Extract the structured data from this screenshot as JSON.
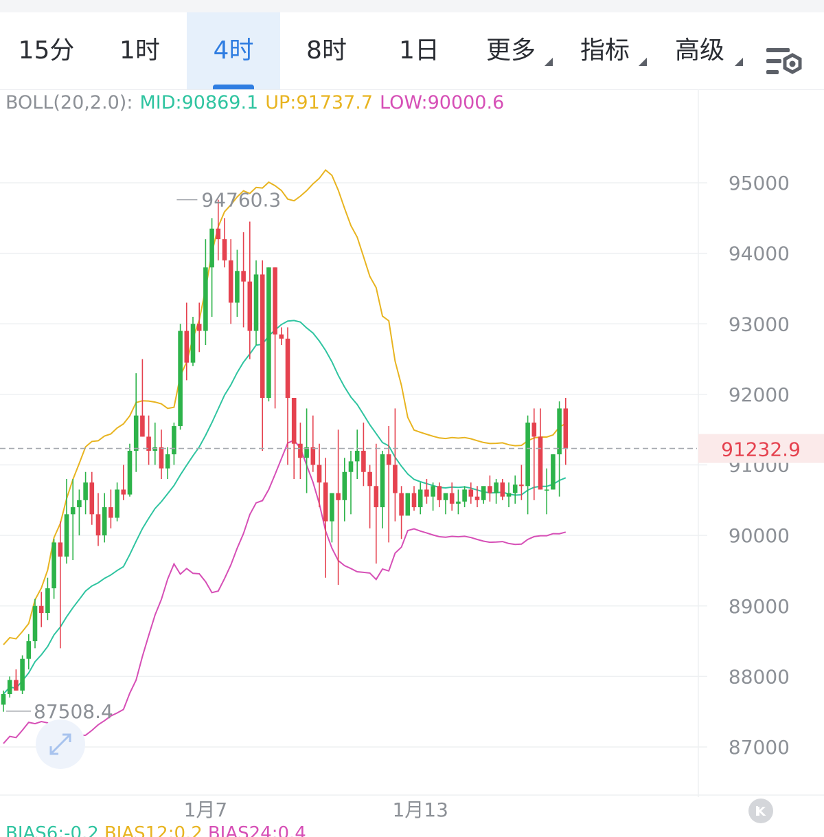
{
  "tabs": [
    {
      "label": "15分",
      "active": false,
      "dropdown": false
    },
    {
      "label": "1时",
      "active": false,
      "dropdown": false
    },
    {
      "label": "4时",
      "active": true,
      "dropdown": false
    },
    {
      "label": "8时",
      "active": false,
      "dropdown": false
    },
    {
      "label": "1日",
      "active": false,
      "dropdown": false
    },
    {
      "label": "更多",
      "active": false,
      "dropdown": true
    },
    {
      "label": "指标",
      "active": false,
      "dropdown": true
    },
    {
      "label": "高级",
      "active": false,
      "dropdown": true
    }
  ],
  "icons": {
    "settings": "chart-settings-icon",
    "collapse": "collapse-k-icon",
    "expand": "expand-arrows-icon"
  },
  "colors": {
    "up": "#2db34a",
    "down": "#e5424f",
    "mid": "#2fc4a0",
    "upper": "#e8b420",
    "lower": "#d64fb6",
    "active_tab": "#2f7de1",
    "price_line": "#e5424f"
  },
  "boll": {
    "name": "BOLL(20,2.0):",
    "mid": "MID:90869.1",
    "up": "UP:91737.7",
    "low": "LOW:90000.6"
  },
  "bias": {
    "b6": "BIAS6:-0.2",
    "b12": "BIAS12:0.2",
    "b24": "BIAS24:0.4"
  },
  "chart_data": {
    "type": "candlestick",
    "y_ticks": [
      95000,
      94000,
      93000,
      92000,
      91000,
      90000,
      89000,
      88000,
      87000
    ],
    "x_labels": [
      {
        "label": "1月7",
        "index": 32
      },
      {
        "label": "1月13",
        "index": 66
      }
    ],
    "current_price": 91232.9,
    "current_price_label": "91232.9",
    "high_label": "94760.3",
    "low_label": "87508.4",
    "high_index": 27,
    "low_index": 0,
    "candles": [
      [
        87600,
        87800,
        87500,
        87750
      ],
      [
        87750,
        88000,
        87700,
        87950
      ],
      [
        87950,
        88100,
        87800,
        87800
      ],
      [
        87800,
        88300,
        87750,
        88250
      ],
      [
        88250,
        88600,
        88100,
        88500
      ],
      [
        88500,
        89100,
        88400,
        89000
      ],
      [
        89000,
        89200,
        88700,
        88900
      ],
      [
        88900,
        89400,
        88800,
        89250
      ],
      [
        89250,
        89950,
        89100,
        89900
      ],
      [
        89900,
        90200,
        88400,
        89700
      ],
      [
        89700,
        90800,
        89600,
        90300
      ],
      [
        90300,
        90800,
        89650,
        90400
      ],
      [
        90400,
        90650,
        90000,
        90500
      ],
      [
        90500,
        90900,
        90300,
        90750
      ],
      [
        90750,
        90900,
        90150,
        90300
      ],
      [
        90300,
        90600,
        89850,
        90000
      ],
      [
        90000,
        90600,
        89900,
        90400
      ],
      [
        90400,
        90650,
        90100,
        90250
      ],
      [
        90250,
        90750,
        90200,
        90650
      ],
      [
        90650,
        91000,
        90500,
        90580
      ],
      [
        90580,
        91300,
        90550,
        91200
      ],
      [
        91200,
        92300,
        90900,
        91700
      ],
      [
        91700,
        92500,
        91400,
        91400
      ],
      [
        91400,
        91700,
        91000,
        91200
      ],
      [
        91200,
        91600,
        91000,
        91250
      ],
      [
        91250,
        91500,
        90800,
        90950
      ],
      [
        90950,
        91250,
        90800,
        91150
      ],
      [
        91150,
        91600,
        91000,
        91550
      ],
      [
        91550,
        93000,
        91500,
        92900
      ],
      [
        92900,
        93300,
        92200,
        92450
      ],
      [
        92450,
        93100,
        92400,
        93000
      ],
      [
        93000,
        93300,
        92600,
        92900
      ],
      [
        92900,
        94200,
        92700,
        93800
      ],
      [
        93800,
        94500,
        93100,
        94350
      ],
      [
        94350,
        94760,
        93900,
        94200
      ],
      [
        94200,
        94500,
        93800,
        93900
      ],
      [
        93900,
        94200,
        93000,
        93300
      ],
      [
        93300,
        94050,
        93100,
        93750
      ],
      [
        93750,
        94300,
        92950,
        93600
      ],
      [
        93600,
        94450,
        92500,
        92900
      ],
      [
        92900,
        93900,
        92700,
        93700
      ],
      [
        93700,
        93900,
        91200,
        91950
      ],
      [
        91950,
        93800,
        91900,
        93800
      ],
      [
        93800,
        93800,
        91800,
        92850
      ],
      [
        92850,
        92950,
        92700,
        92790
      ],
      [
        92790,
        92950,
        91000,
        91950
      ],
      [
        91950,
        91950,
        90800,
        91300
      ],
      [
        91300,
        91600,
        90800,
        91100
      ],
      [
        91100,
        91800,
        90600,
        91250
      ],
      [
        91250,
        91700,
        90900,
        91000
      ],
      [
        91000,
        91300,
        90400,
        90750
      ],
      [
        90750,
        91100,
        89400,
        90200
      ],
      [
        90200,
        90600,
        89900,
        90600
      ],
      [
        90600,
        91500,
        89300,
        90500
      ],
      [
        90500,
        91100,
        90200,
        90900
      ],
      [
        90900,
        91200,
        90300,
        91050
      ],
      [
        91050,
        91500,
        90800,
        91200
      ],
      [
        91200,
        91600,
        90700,
        90900
      ],
      [
        90900,
        91000,
        90100,
        90700
      ],
      [
        90700,
        91300,
        89600,
        90400
      ],
      [
        90400,
        91200,
        90100,
        91150
      ],
      [
        91150,
        91550,
        89900,
        91000
      ],
      [
        91000,
        91800,
        90200,
        90600
      ],
      [
        90600,
        90700,
        89950,
        90280
      ],
      [
        90280,
        90400,
        90600,
        90600
      ],
      [
        90600,
        90700,
        90350,
        90400
      ],
      [
        90400,
        90750,
        90300,
        90650
      ],
      [
        90650,
        90800,
        90450,
        90550
      ],
      [
        90550,
        90750,
        90350,
        90700
      ],
      [
        90700,
        90750,
        90400,
        90500
      ],
      [
        90500,
        90600,
        90300,
        90600
      ],
      [
        90600,
        90750,
        90350,
        90450
      ],
      [
        90450,
        90650,
        90300,
        90480
      ],
      [
        90480,
        90700,
        90400,
        90650
      ],
      [
        90650,
        90750,
        90450,
        90550
      ],
      [
        90550,
        90700,
        90400,
        90500
      ],
      [
        90500,
        90650,
        90450,
        90700
      ],
      [
        90700,
        90850,
        90480,
        90600
      ],
      [
        90600,
        90800,
        90450,
        90750
      ],
      [
        90750,
        90800,
        90500,
        90550
      ],
      [
        90550,
        90750,
        90400,
        90600
      ],
      [
        90600,
        90850,
        90450,
        90720
      ],
      [
        90720,
        91000,
        90500,
        90700
      ],
      [
        90700,
        91700,
        90300,
        91600
      ],
      [
        91600,
        91800,
        90500,
        91400
      ],
      [
        91400,
        91800,
        90650,
        90650
      ],
      [
        90650,
        90950,
        90300,
        90650
      ],
      [
        90650,
        91150,
        90650,
        91150
      ],
      [
        91150,
        91900,
        90550,
        91800
      ],
      [
        91800,
        91950,
        91000,
        91233
      ]
    ]
  }
}
